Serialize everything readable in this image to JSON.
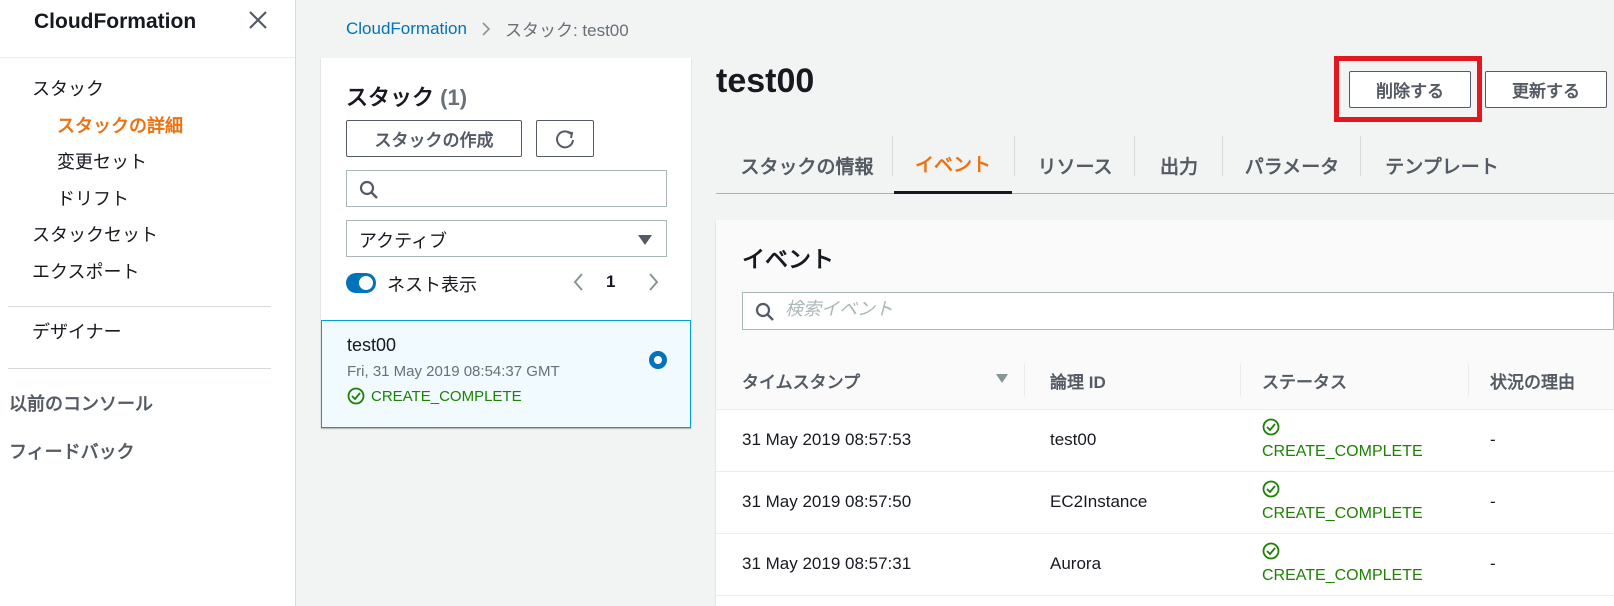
{
  "sidebar": {
    "title": "CloudFormation",
    "items": [
      {
        "label": "スタック"
      },
      {
        "label": "スタックの詳細"
      },
      {
        "label": "変更セット"
      },
      {
        "label": "ドリフト"
      },
      {
        "label": "スタックセット"
      },
      {
        "label": "エクスポート"
      },
      {
        "label": "デザイナー"
      },
      {
        "label": "以前のコンソール"
      },
      {
        "label": "フィードバック"
      }
    ]
  },
  "breadcrumb": {
    "root": "CloudFormation",
    "current": "スタック: test00"
  },
  "stack_panel": {
    "title": "スタック",
    "count": "(1)",
    "create_label": "スタックの作成",
    "filter_value": "アクティブ",
    "nested_label": "ネスト表示",
    "page": "1",
    "stacks": [
      {
        "name": "test00",
        "date": "Fri, 31 May 2019 08:54:37 GMT",
        "status": "CREATE_COMPLETE"
      }
    ]
  },
  "detail": {
    "title": "test00",
    "delete_label": "削除する",
    "update_label": "更新する",
    "tabs": [
      {
        "label": "スタックの情報"
      },
      {
        "label": "イベント"
      },
      {
        "label": "リソース"
      },
      {
        "label": "出力"
      },
      {
        "label": "パラメータ"
      },
      {
        "label": "テンプレート"
      }
    ]
  },
  "events": {
    "title": "イベント",
    "search_placeholder": "検索イベント",
    "columns": [
      "タイムスタンプ",
      "論理 ID",
      "ステータス",
      "状況の理由"
    ],
    "rows": [
      {
        "timestamp": "31 May 2019 08:57:53",
        "logical_id": "test00",
        "status": "CREATE_COMPLETE",
        "reason": "-"
      },
      {
        "timestamp": "31 May 2019 08:57:50",
        "logical_id": "EC2Instance",
        "status": "CREATE_COMPLETE",
        "reason": "-"
      },
      {
        "timestamp": "31 May 2019 08:57:31",
        "logical_id": "Aurora",
        "status": "CREATE_COMPLETE",
        "reason": "-"
      }
    ]
  },
  "colors": {
    "accent": "#ec7211",
    "link": "#0073bb",
    "success": "#1d8102",
    "highlight_frame": "#e3171f"
  },
  "icons": [
    "close-icon",
    "chevron-right-icon",
    "refresh-icon",
    "search-icon",
    "caret-down-icon",
    "chevron-left-icon",
    "success-check-icon",
    "sort-caret-icon"
  ]
}
